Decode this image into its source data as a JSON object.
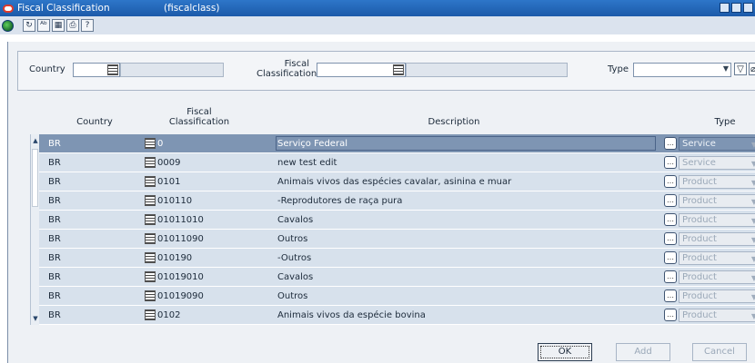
{
  "window": {
    "title": "Fiscal Classification",
    "subtitle": "(fiscalclass)"
  },
  "toolbar": {
    "icons": [
      "globe-icon",
      "undo-icon",
      "spellcheck-icon",
      "calendar-icon",
      "print-icon",
      "help-icon"
    ],
    "glyphs": [
      "↻",
      "ᴬᵇ",
      "▦",
      "⎙",
      "?"
    ]
  },
  "search": {
    "country_label": "Country",
    "fiscal_label_line1": "Fiscal",
    "fiscal_label_line2": "Classification",
    "type_label": "Type"
  },
  "table": {
    "headers": {
      "country": "Country",
      "fiscal_line1": "Fiscal",
      "fiscal_line2": "Classification",
      "description": "Description",
      "type": "Type"
    },
    "rows": [
      {
        "country": "BR",
        "code": "0",
        "description": "Serviço Federal",
        "type": "Service",
        "selected": true
      },
      {
        "country": "BR",
        "code": "0009",
        "description": "new test edit",
        "type": "Service"
      },
      {
        "country": "BR",
        "code": "0101",
        "description": "Animais vivos das espécies cavalar, asinina e muar",
        "type": "Product"
      },
      {
        "country": "BR",
        "code": "010110",
        "description": "-Reprodutores de raça pura",
        "type": "Product"
      },
      {
        "country": "BR",
        "code": "01011010",
        "description": "Cavalos",
        "type": "Product"
      },
      {
        "country": "BR",
        "code": "01011090",
        "description": "Outros",
        "type": "Product"
      },
      {
        "country": "BR",
        "code": "010190",
        "description": "-Outros",
        "type": "Product"
      },
      {
        "country": "BR",
        "code": "01019010",
        "description": "Cavalos",
        "type": "Product"
      },
      {
        "country": "BR",
        "code": "01019090",
        "description": "Outros",
        "type": "Product"
      },
      {
        "country": "BR",
        "code": "0102",
        "description": "Animais vivos da espécie bovina",
        "type": "Product"
      }
    ]
  },
  "buttons": {
    "ok": "OK",
    "add": "Add",
    "cancel": "Cancel"
  }
}
